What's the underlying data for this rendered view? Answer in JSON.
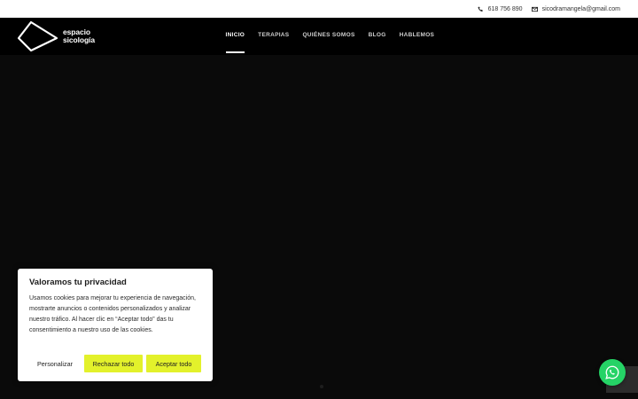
{
  "topbar": {
    "phone": "618 756 890",
    "email": "sicodramangela@gmail.com"
  },
  "logo": {
    "line1": "espacio",
    "line2": "sicología"
  },
  "nav": {
    "items": [
      "INICIO",
      "TERAPIAS",
      "QUIÉNES SOMOS",
      "BLOG",
      "HABLEMOS"
    ],
    "active": "INICIO"
  },
  "cookie": {
    "title": "Valoramos tu privacidad",
    "text": "Usamos cookies para mejorar tu experiencia de navegación, mostrarte anuncios o contenidos personalizados y analizar nuestro tráfico. Al hacer clic en “Aceptar todo” das tu consentimiento a nuestro uso de las cookies.",
    "customize_label": "Personalizar",
    "reject_label": "Rechazar todo",
    "accept_label": "Aceptar todo"
  },
  "colors": {
    "accent": "#e3f12b",
    "whatsapp": "#25d366",
    "background": "#0a0a0a"
  },
  "icons": {
    "phone": "phone-icon",
    "email": "envelope-icon",
    "chat": "whatsapp-icon"
  }
}
